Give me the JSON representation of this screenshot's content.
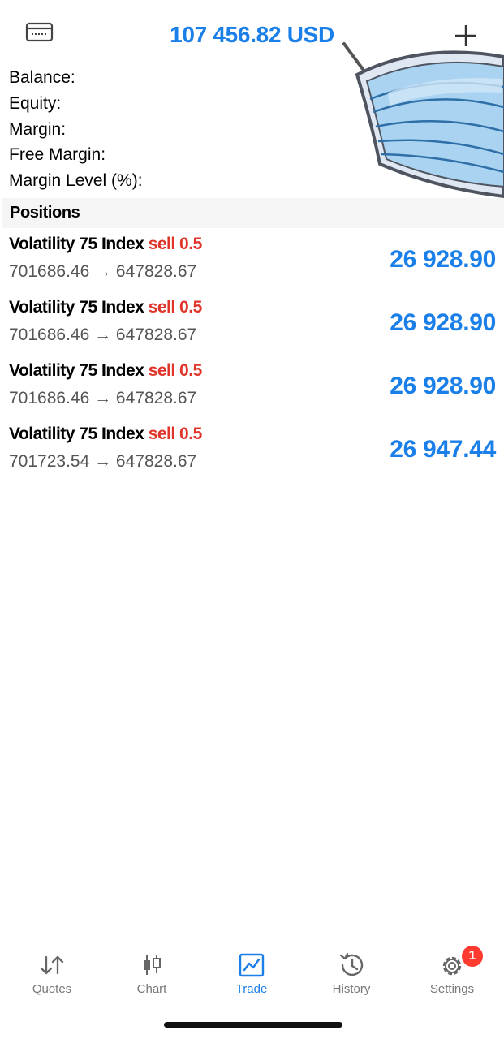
{
  "header": {
    "total": "107 456.82 USD",
    "wallet_icon": "wallet-icon",
    "add_icon": "plus-icon"
  },
  "summary": {
    "rows": [
      {
        "label": "Balance:"
      },
      {
        "label": "Equity:"
      },
      {
        "label": "Margin:"
      },
      {
        "label": "Free Margin:"
      },
      {
        "label": "Margin Level (%):"
      }
    ]
  },
  "positions": {
    "title": "Positions",
    "items": [
      {
        "symbol": "Volatility 75 Index",
        "side": "sell 0.5",
        "prices": "701686.46 → 647828.67",
        "profit": "26 928.90"
      },
      {
        "symbol": "Volatility 75 Index",
        "side": "sell 0.5",
        "prices": "701686.46 → 647828.67",
        "profit": "26 928.90"
      },
      {
        "symbol": "Volatility 75 Index",
        "side": "sell 0.5",
        "prices": "701686.46 → 647828.67",
        "profit": "26 928.90"
      },
      {
        "symbol": "Volatility 75 Index",
        "side": "sell 0.5",
        "prices": "701723.54 → 647828.67",
        "profit": "26 947.44"
      }
    ]
  },
  "tabbar": {
    "tabs": [
      {
        "label": "Quotes",
        "icon": "quotes-arrows-icon"
      },
      {
        "label": "Chart",
        "icon": "candlestick-icon"
      },
      {
        "label": "Trade",
        "icon": "trade-chart-icon",
        "active": true
      },
      {
        "label": "History",
        "icon": "history-clock-icon"
      },
      {
        "label": "Settings",
        "icon": "gear-icon",
        "badge": "1"
      }
    ]
  },
  "colors": {
    "accent": "#1a7fe8",
    "sell": "#e0352b",
    "badge": "#ff3b30"
  }
}
